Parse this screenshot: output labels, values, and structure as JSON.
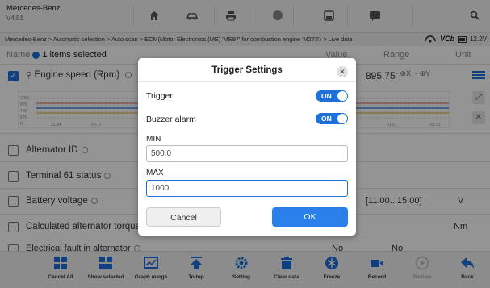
{
  "brand": {
    "name": "Mercedes-Benz",
    "version": "V4.51"
  },
  "breadcrumb": "Mercedes-Benz > Automatic selection > Auto scan > ECM(Motor Electronics (ME) 'ME97' for combustion engine 'M272') > Live data",
  "status": {
    "vci_label": "VCb",
    "battery": "12.2V"
  },
  "table_header": {
    "name": "1 items selected",
    "value": "Value",
    "range": "Range",
    "unit": "Unit"
  },
  "rows": [
    {
      "label": "Engine speed",
      "unit_inline": "(Rpm)",
      "value": "895.75",
      "checked": true
    },
    {
      "label": "Alternator ID",
      "value": "",
      "range": "",
      "unit": ""
    },
    {
      "label": "Terminal 61 status",
      "value": "",
      "range": "",
      "unit": ""
    },
    {
      "label": "Battery voltage",
      "value": "",
      "range": "[11.00...15.00]",
      "unit": "V"
    },
    {
      "label": "Calculated alternator torque",
      "value": "",
      "range": "",
      "unit": "Nm"
    },
    {
      "label": "Electrical fault in alternator",
      "value": "No",
      "range": "No",
      "unit": ""
    }
  ],
  "graph": {
    "y_ticks": [
      "1000",
      "875",
      "750",
      "625",
      "0"
    ],
    "x_ticks": [
      "21:34",
      "00:17",
      "01:01",
      "01:31"
    ]
  },
  "zoom": {
    "x_label": "X",
    "y_label": "Y"
  },
  "dialog": {
    "title": "Trigger Settings",
    "trigger_label": "Trigger",
    "trigger_state": "ON",
    "buzzer_label": "Buzzer alarm",
    "buzzer_state": "ON",
    "min_label": "MIN",
    "min_value": "500.0",
    "max_label": "MAX",
    "max_value": "1000",
    "cancel_label": "Cancel",
    "ok_label": "OK"
  },
  "toolbar": {
    "cancel_all": "Cancel All",
    "show_selected": "Show selected",
    "graph_merge": "Graph merge",
    "to_top": "To top",
    "setting": "Setting",
    "clear_data": "Clear data",
    "freeze": "Freeze",
    "record": "Record",
    "review": "Review",
    "back": "Back"
  },
  "colors": {
    "accent": "#1e6fd9",
    "ok_button": "#2a7fe8"
  }
}
